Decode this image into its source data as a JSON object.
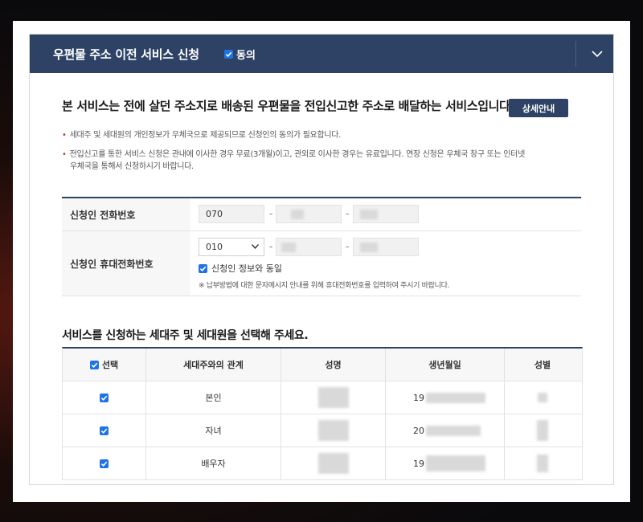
{
  "header": {
    "title": "우편물 주소 이전 서비스 신청",
    "agree_label": "동의",
    "agree_checked": true,
    "expand_icon": "chevron-down-icon"
  },
  "intro": {
    "text": "본 서비스는 전에 살던 주소지로 배송된 우편물을 전입신고한 주소로 배달하는 서비스입니다.",
    "detail_button": "상세안내"
  },
  "notes": [
    "세대주 및 세대원의 개인정보가 우체국으로 제공되므로 신청인의 동의가 필요합니다.",
    "전입신고를 통한 서비스 신청은 관내에 이사한 경우 무료(3개월)이고, 관외로 이사한 경우는 유료입니다. 연장 신청은 우체국 창구 또는 인터넷",
    "우체국을 통해서 신청하시기 바랍니다."
  ],
  "form": {
    "phone_label": "신청인 전화번호",
    "phone_prefix": "070",
    "phone_suffix_visible": "",
    "mobile_label": "신청인 휴대전화번호",
    "mobile_prefix_selected": "010",
    "same_as_applicant_label": "신청인 정보와 동일",
    "same_as_applicant_checked": true,
    "mobile_note": "※ 납부방법에 대한 문자메시지 안내를 위해 휴대전화번호를 입력하여 주시기 바랍니다."
  },
  "members": {
    "section_title": "서비스를 신청하는 세대주 및 세대원을 선택해 주세요.",
    "headers": {
      "select": "선택",
      "relation": "세대주와의 관계",
      "name": "성명",
      "birth": "생년월일",
      "gender": "성별"
    },
    "rows": [
      {
        "relation": "본인",
        "birth_prefix": "19",
        "checked": true
      },
      {
        "relation": "자녀",
        "birth_prefix": "20",
        "checked": true
      },
      {
        "relation": "배우자",
        "birth_prefix": "19",
        "checked": true
      }
    ]
  },
  "colors": {
    "header_bg": "#2e4266",
    "checkbox": "#1e73e8",
    "bullet": "#c23b22"
  }
}
